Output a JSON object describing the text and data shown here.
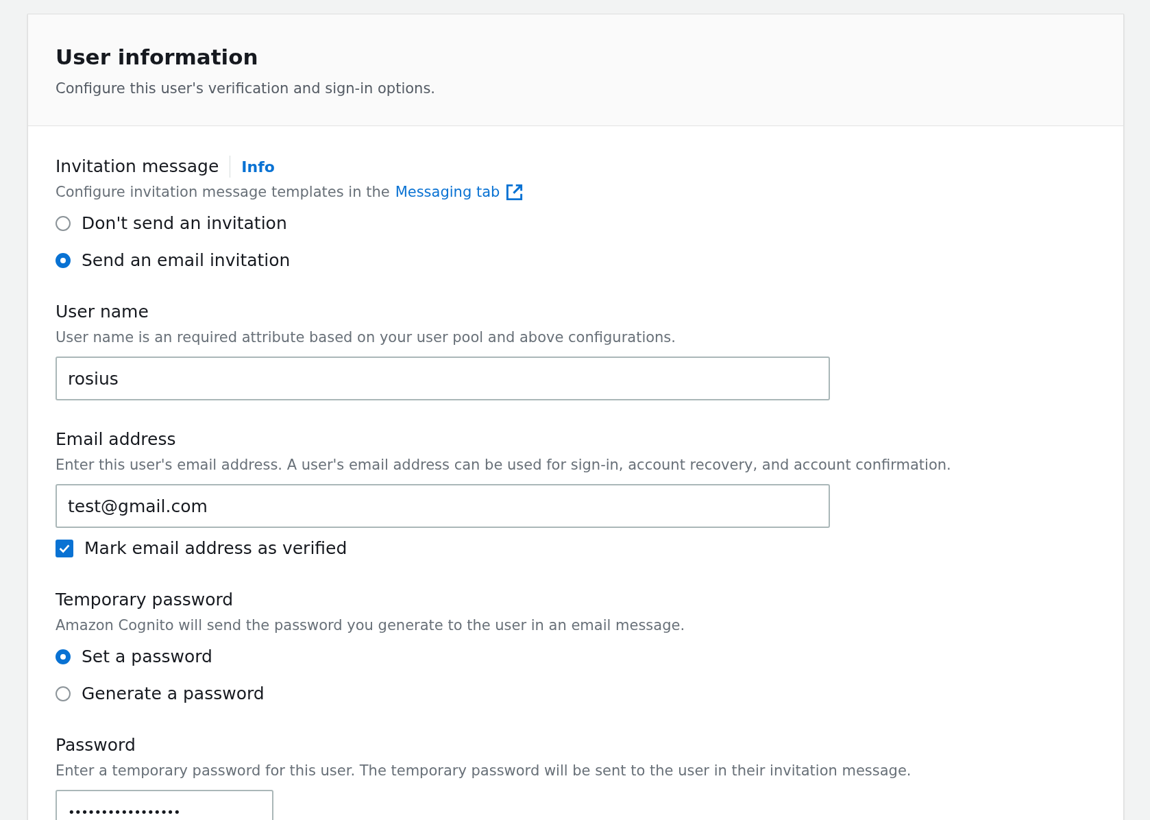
{
  "header": {
    "title": "User information",
    "description": "Configure this user's verification and sign-in options."
  },
  "invitation": {
    "label": "Invitation message",
    "info": "Info",
    "description": "Configure invitation message templates in the",
    "link": "Messaging tab",
    "options": [
      {
        "label": "Don't send an invitation",
        "selected": false
      },
      {
        "label": "Send an email invitation",
        "selected": true
      }
    ]
  },
  "user_name": {
    "label": "User name",
    "description": "User name is an required attribute based on your user pool and above configurations.",
    "value": "rosius"
  },
  "email": {
    "label": "Email address",
    "description": "Enter this user's email address. A user's email address can be used for sign-in, account recovery, and account confirmation.",
    "value": "test@gmail.com",
    "verified": {
      "label": "Mark email address as verified",
      "checked": true
    }
  },
  "temporary_password": {
    "label": "Temporary password",
    "description": "Amazon Cognito will send the password you generate to the user in an email message.",
    "options": [
      {
        "label": "Set a password",
        "selected": true
      },
      {
        "label": "Generate a password",
        "selected": false
      }
    ]
  },
  "password": {
    "label": "Password",
    "description": "Enter a temporary password for this user. The temporary password will be sent to the user in their invitation message.",
    "value": "•••••••••••••••••"
  }
}
